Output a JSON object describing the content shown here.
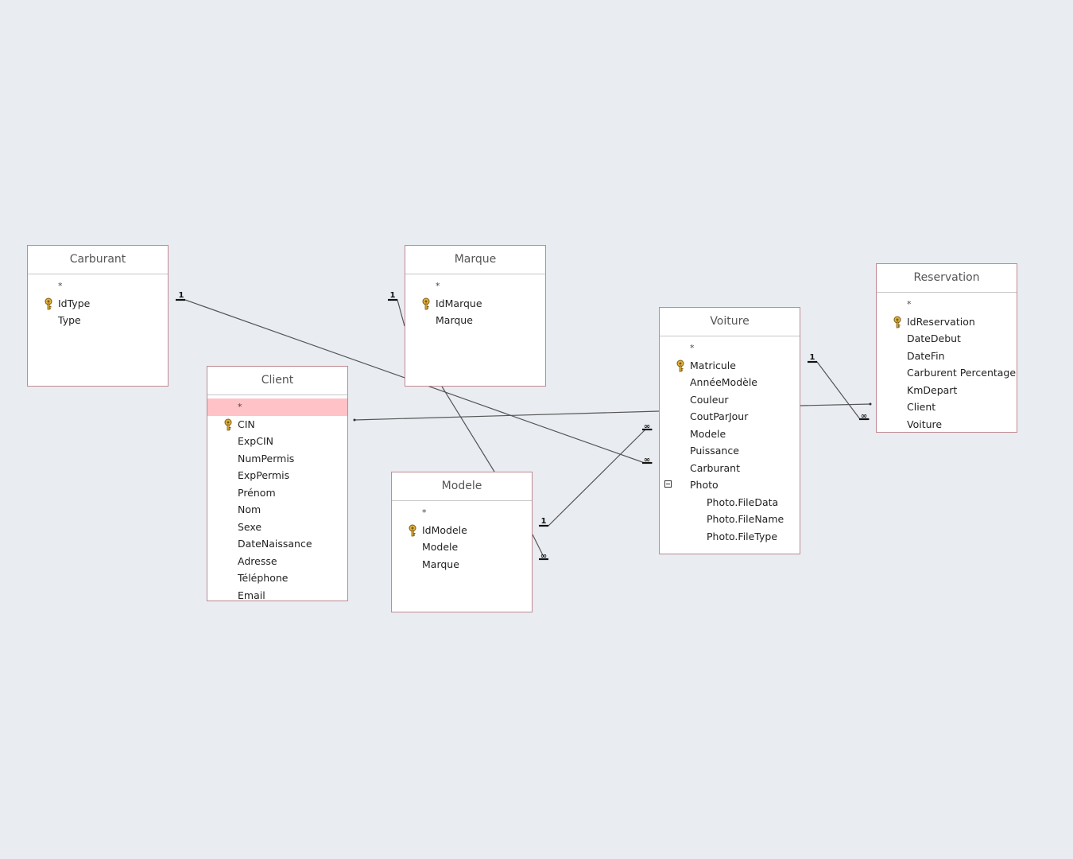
{
  "tables": {
    "carburant": {
      "title": "Carburant",
      "fields": [
        {
          "name": "*",
          "type": "star"
        },
        {
          "name": "IdType",
          "type": "key"
        },
        {
          "name": "Type"
        }
      ]
    },
    "marque": {
      "title": "Marque",
      "fields": [
        {
          "name": "*",
          "type": "star"
        },
        {
          "name": "IdMarque",
          "type": "key"
        },
        {
          "name": "Marque"
        }
      ]
    },
    "client": {
      "title": "Client",
      "fields": [
        {
          "name": "*",
          "type": "star",
          "selected": true
        },
        {
          "name": "CIN",
          "type": "key"
        },
        {
          "name": "ExpCIN"
        },
        {
          "name": "NumPermis"
        },
        {
          "name": "ExpPermis"
        },
        {
          "name": "Prénom"
        },
        {
          "name": "Nom"
        },
        {
          "name": "Sexe"
        },
        {
          "name": "DateNaissance"
        },
        {
          "name": "Adresse"
        },
        {
          "name": "Téléphone"
        },
        {
          "name": "Email"
        }
      ]
    },
    "modele": {
      "title": "Modele",
      "fields": [
        {
          "name": "*",
          "type": "star"
        },
        {
          "name": "IdModele",
          "type": "key"
        },
        {
          "name": "Modele"
        },
        {
          "name": "Marque"
        }
      ]
    },
    "voiture": {
      "title": "Voiture",
      "fields": [
        {
          "name": "*",
          "type": "star"
        },
        {
          "name": "Matricule",
          "type": "key"
        },
        {
          "name": "AnnéeModèle"
        },
        {
          "name": "Couleur"
        },
        {
          "name": "CoutParJour"
        },
        {
          "name": "Modele"
        },
        {
          "name": "Puissance"
        },
        {
          "name": "Carburant"
        },
        {
          "name": "Photo",
          "type": "collapse"
        },
        {
          "name": "Photo.FileData",
          "type": "indented"
        },
        {
          "name": "Photo.FileName",
          "type": "indented"
        },
        {
          "name": "Photo.FileType",
          "type": "indented"
        }
      ]
    },
    "reservation": {
      "title": "Reservation",
      "fields": [
        {
          "name": "*",
          "type": "star"
        },
        {
          "name": "IdReservation",
          "type": "key"
        },
        {
          "name": "DateDebut"
        },
        {
          "name": "DateFin"
        },
        {
          "name": "Carburent Percentage"
        },
        {
          "name": "KmDepart"
        },
        {
          "name": "Client"
        },
        {
          "name": "Voiture"
        }
      ]
    }
  },
  "relationships": [
    {
      "name": "carburant-voiture",
      "one": "1",
      "many": "∞"
    },
    {
      "name": "marque-modele",
      "one": "1",
      "many": ""
    },
    {
      "name": "modele-voiture",
      "one": "1",
      "many": "∞"
    },
    {
      "name": "voiture-reservation",
      "one": "1",
      "many": "∞"
    },
    {
      "name": "client-reservation",
      "one": "",
      "many": ""
    },
    {
      "name": "modele-self",
      "one": "",
      "many": "∞"
    }
  ],
  "colors": {
    "background": "#e9ecf1",
    "table_border": "#c08a92",
    "selected_row": "#ffc2c7",
    "line": "#555555"
  },
  "icons": {
    "key": "key-icon",
    "collapse": "collapse-icon"
  }
}
